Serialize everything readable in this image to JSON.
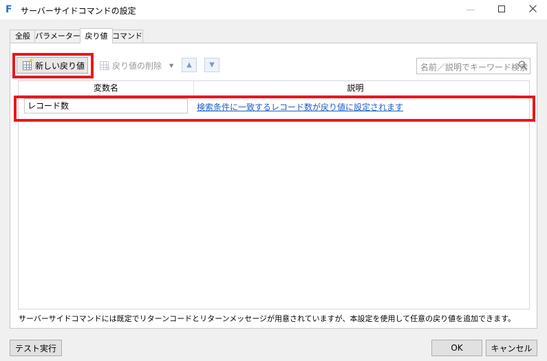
{
  "window": {
    "title": "サーバーサイドコマンドの設定",
    "app_icon": "F",
    "minimize_icon": "minimize-icon",
    "maximize_icon": "maximize-icon",
    "close_icon": "close-icon"
  },
  "tabs": [
    {
      "label": "全般",
      "active": false
    },
    {
      "label": "パラメーター",
      "active": false
    },
    {
      "label": "戻り値",
      "active": true
    },
    {
      "label": "コマンド",
      "active": false
    }
  ],
  "toolbar": {
    "new_label": "新しい戻り値",
    "delete_label": "戻り値の削除",
    "move_up_icon": "triangle-up-icon",
    "move_down_icon": "triangle-down-icon",
    "search_placeholder": "名前／説明でキーワード検索"
  },
  "table": {
    "columns": [
      "変数名",
      "説明"
    ],
    "rows": [
      {
        "name": "レコード数",
        "description": "検索条件に一致するレコード数が戻り値に設定されます"
      }
    ]
  },
  "note": "サーバーサイドコマンドには既定でリターンコードとリターンメッセージが用意されていますが、本設定を使用して任意の戻り値を追加できます。",
  "footer": {
    "test_label": "テスト実行",
    "ok_label": "OK",
    "cancel_label": "キャンセル"
  },
  "colors": {
    "highlight": "#e8171f",
    "link": "#1a5fc7",
    "app_icon": "#1f6fd1"
  }
}
